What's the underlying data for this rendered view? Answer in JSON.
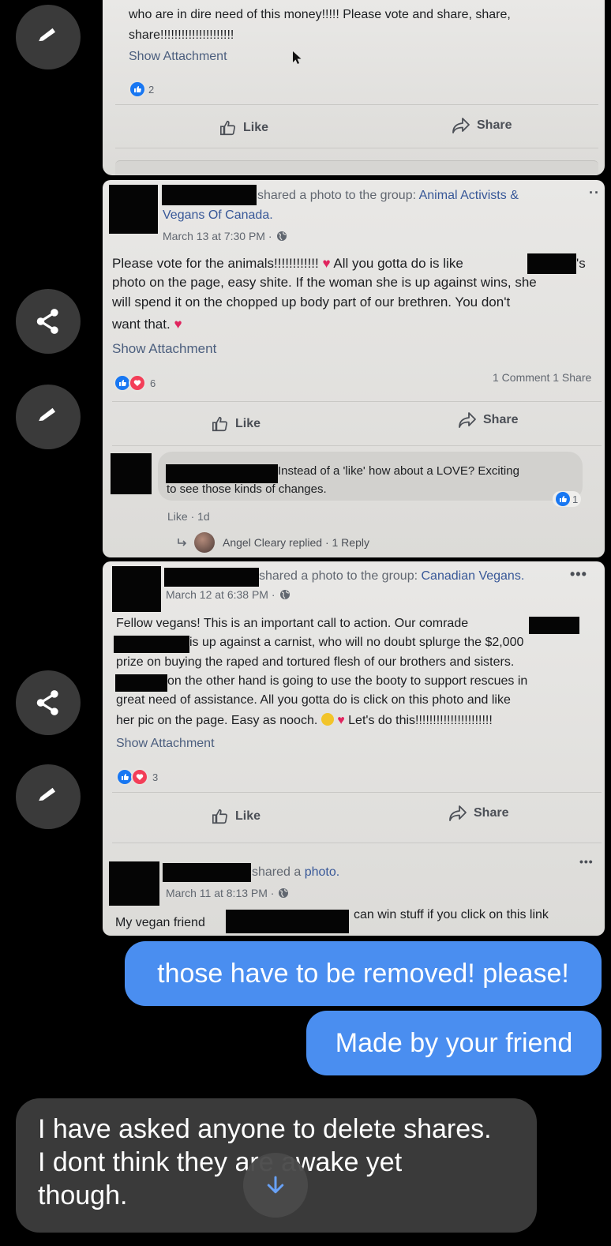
{
  "panel1": {
    "line1": "who are in dire need of this money!!!!! Please vote and share, share,",
    "line2": "share!!!!!!!!!!!!!!!!!!!!!",
    "show_attachment": "Show Attachment",
    "reaction_count": "2",
    "like": "Like",
    "share": "Share"
  },
  "post1": {
    "shared_text": "shared a photo to the group:",
    "group_line1": "Animal Activists &",
    "group_line2": "Vegans Of Canada.",
    "timestamp": "March 13 at 7:30 PM ·",
    "body1_a": "Please vote for the animals!!!!!!!!!!!!",
    "body1_b": "All you gotta do is like",
    "body1_c": "'s",
    "body2": "photo on the page, easy shite. If the woman she is up against wins, she",
    "body3": "will spend it on the chopped up body part of our brethren. You don't",
    "body4": "want that.",
    "show_attachment": "Show Attachment",
    "reaction_count": "6",
    "comments_shares": "1 Comment 1 Share",
    "like": "Like",
    "share": "Share",
    "comment_line1": "Instead of a 'like' how about a LOVE? Exciting",
    "comment_line2": "to see those kinds of changes.",
    "comment_like_count": "1",
    "comment_meta": "Like · 1d",
    "reply_text": "Angel Cleary replied · 1 Reply"
  },
  "post2": {
    "shared_text": "shared a photo to the group:",
    "group": "Canadian Vegans.",
    "timestamp": "March 12 at 6:38 PM ·",
    "body1": "Fellow vegans! This is an important call to action. Our comrade",
    "body2": "is up against a carnist, who will no doubt splurge the $2,000",
    "body3": "prize on buying the raped and tortured flesh of our brothers and sisters.",
    "body4": "on the other hand is going to use the booty to support rescues in",
    "body5": "great need of assistance. All you gotta do is click on this photo and like",
    "body6_a": "her pic on the page. Easy as nooch.",
    "body6_b": "Let's do this!!!!!!!!!!!!!!!!!!!!!!",
    "show_attachment": "Show Attachment",
    "reaction_count": "3",
    "like": "Like",
    "share": "Share"
  },
  "post3": {
    "shared_text": "shared a",
    "photo_link": "photo.",
    "timestamp": "March 11 at 8:13 PM ·",
    "body_a": "My vegan friend",
    "body_b": "can win stuff if you click on this link"
  },
  "messages": {
    "out1": "those have to be removed! please!",
    "out2": "Made by your friend",
    "in1_line1": "I have asked anyone to delete shares.",
    "in1_line2": "I dont think they are awake yet",
    "in1_line3": "though."
  },
  "icons": {
    "edit": "pencil-icon",
    "share": "share-icon",
    "scroll": "arrow-down-icon"
  },
  "colors": {
    "bubble_outgoing": "#4a8ef0",
    "bubble_incoming": "#3a3a3a",
    "background": "#000000",
    "fb_link": "#385898"
  }
}
